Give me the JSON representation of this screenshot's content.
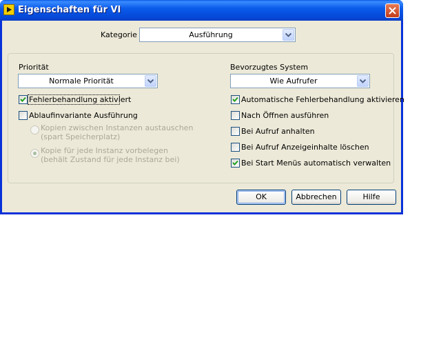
{
  "window": {
    "title": "Eigenschaften für VI",
    "icon": "labview-vi-icon"
  },
  "category": {
    "label": "Kategorie",
    "value": "Ausführung"
  },
  "priority": {
    "label": "Priorität",
    "value": "Normale Priorität"
  },
  "preferred_system": {
    "label": "Bevorzugtes System",
    "value": "Wie Aufrufer"
  },
  "left_options": {
    "error_handling": {
      "label": "Fehlerbehandlung aktiviert",
      "checked": true
    },
    "reentrant": {
      "label": "Ablaufinvariante Ausführung",
      "checked": false
    },
    "radio_share_line1": "Kopien zwischen Instanzen austauschen",
    "radio_share_line2": "(spart Speicherplatz)",
    "radio_preallocate_line1": "Kopie für jede Instanz vorbelegen",
    "radio_preallocate_line2": "(behält Zustand für jede Instanz bei)",
    "radio_selected": "preallocate"
  },
  "right_options": [
    {
      "label": "Automatische Fehlerbehandlung aktivieren",
      "checked": true
    },
    {
      "label": "Nach Öffnen ausführen",
      "checked": false
    },
    {
      "label": "Bei Aufruf anhalten",
      "checked": false
    },
    {
      "label": "Bei Aufruf Anzeigeinhalte löschen",
      "checked": false
    },
    {
      "label": "Bei Start Menüs automatisch verwalten",
      "checked": true
    }
  ],
  "buttons": {
    "ok": "OK",
    "cancel": "Abbrechen",
    "help": "Hilfe"
  },
  "colors": {
    "titlebar": "#0b5bea",
    "dialog_bg": "#ece9d8",
    "check": "#21a121"
  }
}
